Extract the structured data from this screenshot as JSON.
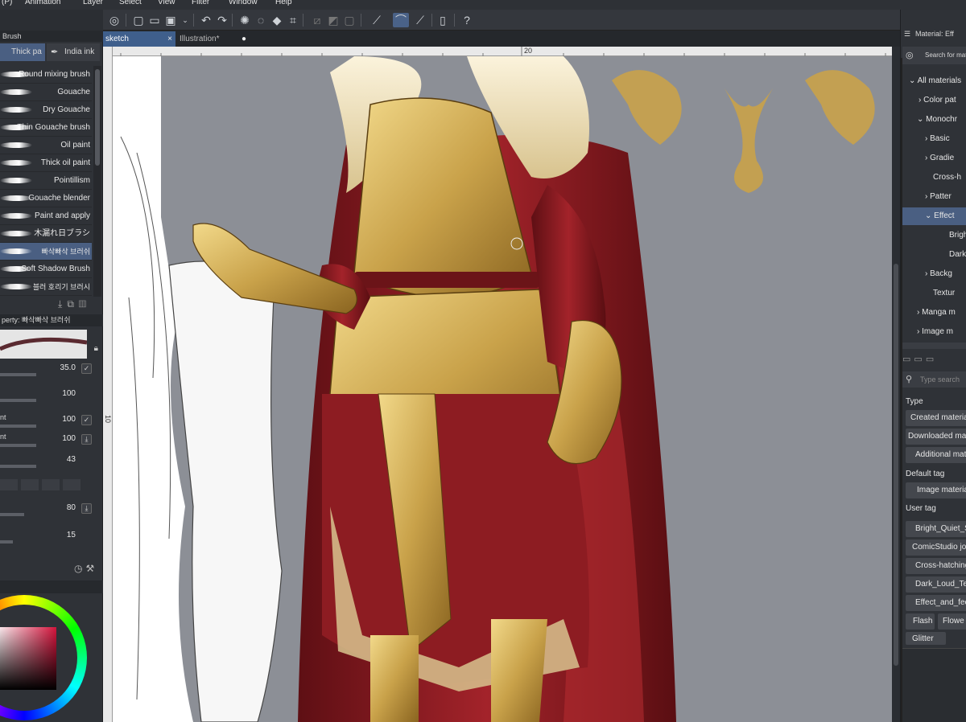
{
  "menu": [
    "(P)",
    "Animation",
    "Layer",
    "Select",
    "View",
    "Filter",
    "Window",
    "Help"
  ],
  "tabs": [
    {
      "label": "sketch",
      "close": "×"
    },
    {
      "label": "Illustration*",
      "close": "●"
    }
  ],
  "ruler": {
    "top_mark": "20",
    "left_mark": "10"
  },
  "left_panel": {
    "header": "Brush",
    "brush_tabs": [
      "Thick pa",
      "India ink"
    ],
    "brushes": [
      "Round mixing brush",
      "Gouache",
      "Dry Gouache",
      "Thin Gouache brush",
      "Oil paint",
      "Thick oil paint",
      "Pointillism",
      "Gouache blender",
      "Paint and apply",
      "木漏れ日ブラシ",
      "빠삭빠삭 브러쉬",
      "Soft Shadow Brush",
      "블러 호리기 브러시"
    ],
    "selected_brush_index": 10,
    "property_header": "perty: 빠삭빠삭 브러쉬",
    "sliders": [
      {
        "label": "",
        "value": "35.0"
      },
      {
        "label": "",
        "value": "100"
      },
      {
        "label": "nt",
        "value": "100"
      },
      {
        "label": "nt",
        "value": "100"
      },
      {
        "label": "",
        "value": "43"
      },
      {
        "label": "",
        "value": "80"
      },
      {
        "label": "",
        "value": "15"
      }
    ]
  },
  "right_panel": {
    "header": "Material: Eff",
    "search_placeholder": "Search for materi",
    "tree": [
      "All materials",
      "Color pat",
      "Monochr",
      "Basic",
      "Gradie",
      "Cross-h",
      "Patter",
      "Effect",
      "Brigh",
      "Dark",
      "Backg",
      "Textur",
      "Manga m",
      "Image m"
    ],
    "selected_tree_index": 7,
    "tag_search_placeholder": "Type search",
    "type_label": "Type",
    "type_buttons": [
      "Created materia",
      "Downloaded ma",
      "Additional mate"
    ],
    "default_tag_label": "Default tag",
    "default_tags": [
      "Image material"
    ],
    "user_tag_label": "User tag",
    "user_tags": [
      "Bright_Quiet_S",
      "ComicStudio jou",
      "Cross-hatching",
      "Dark_Loud_Te",
      "Effect_and_fee"
    ],
    "user_tags_row": [
      "Flash",
      "Flowe"
    ],
    "user_tags_last": [
      "Glitter"
    ]
  },
  "colors": {
    "accent": "#4a5f82",
    "tab_active": "#3f5f8c",
    "canvas_bg": "#8c8f96",
    "gold": "#c9a24a",
    "crimson": "#7d1a1e"
  }
}
